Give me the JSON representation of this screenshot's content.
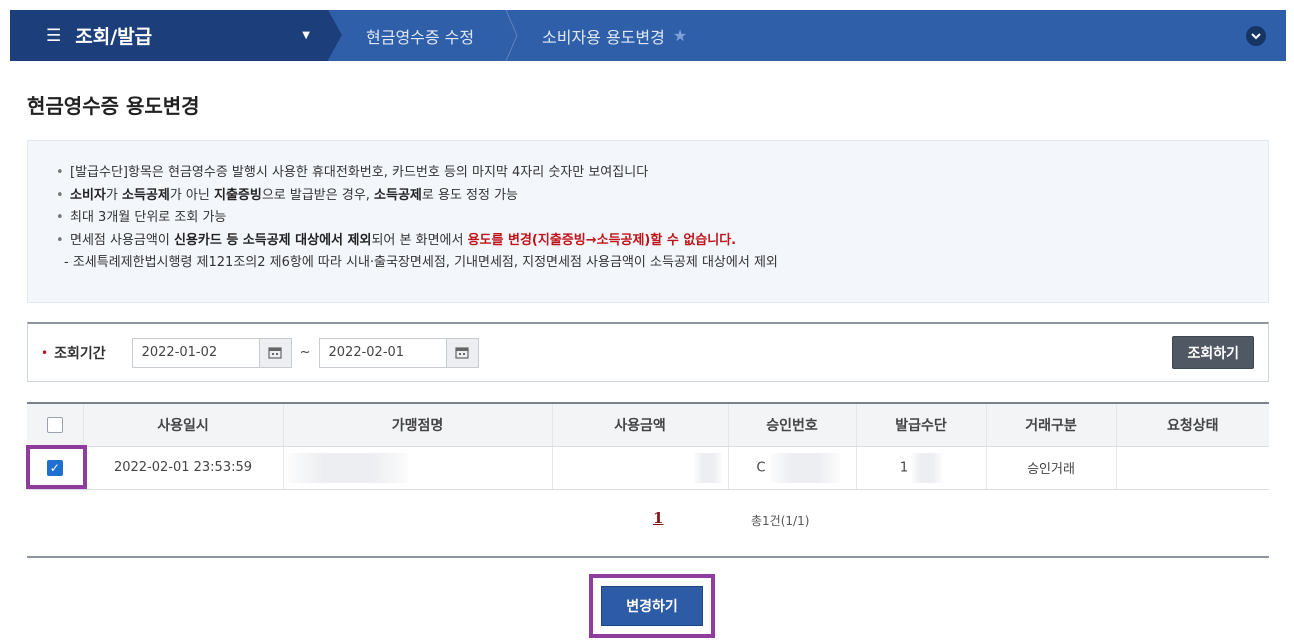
{
  "nav": {
    "menu_label": "조회/발급",
    "crumb1": "현금영수증 수정",
    "crumb2": "소비자용 용도변경"
  },
  "page_title": "현금영수증 용도변경",
  "info": {
    "line1": "[발급수단]항목은 현금영수증 발행시 사용한 휴대전화번호, 카드번호 등의 마지막 4자리 숫자만 보여집니다",
    "line2": {
      "a": "소비자",
      "b": "가 ",
      "c": "소득공제",
      "d": "가 아닌 ",
      "e": "지출증빙",
      "f": "으로 발급받은 경우, ",
      "g": "소득공제",
      "h": "로 용도 정정 가능"
    },
    "line3": "최대 3개월 단위로 조회 가능",
    "line4": {
      "a": "면세점 사용금액이 ",
      "b": "신용카드 등 소득공제 대상에서 제외",
      "c": "되어 본 화면에서 ",
      "d": "용도를 변경(지출증빙→소득공제)할 수 없습니다."
    },
    "line5": "- 조세특례제한법시행령 제121조의2 제6항에 따라 시내·출국장면세점,  기내면세점, 지정면세점 사용금액이 소득공제 대상에서 제외"
  },
  "search": {
    "label": "조회기간",
    "required_mark": "•",
    "start_date": "2022-01-02",
    "separator": "~",
    "end_date": "2022-02-01",
    "button": "조회하기"
  },
  "table": {
    "headers": [
      "사용일시",
      "가맹점명",
      "사용금액",
      "승인번호",
      "발급수단",
      "거래구분",
      "요청상태"
    ],
    "rows": [
      {
        "checked": true,
        "date": "2022-02-01 23:53:59",
        "merchant": "",
        "amount": "",
        "approval": "C",
        "issue_means": "1",
        "type": "승인거래",
        "status": ""
      }
    ]
  },
  "pagination": {
    "current": "1",
    "total": "총1건(1/1)"
  },
  "change_button": "변경하기"
}
